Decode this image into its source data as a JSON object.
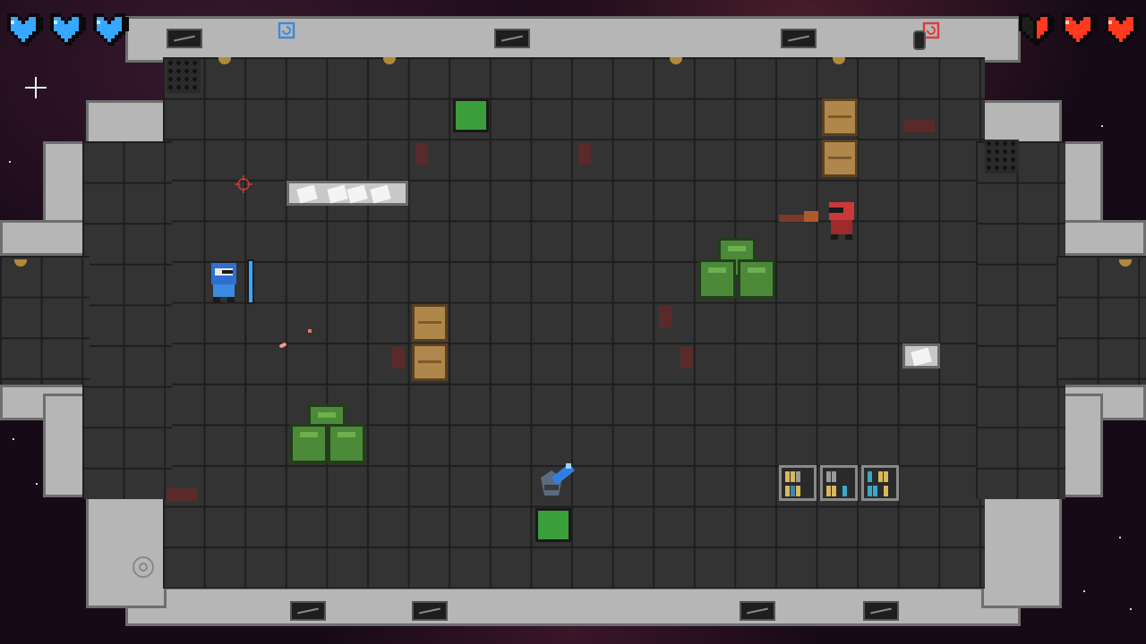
{
  "hud": {
    "blue_player": {
      "hearts_full": 3,
      "hearts_max": 3,
      "color": "#3aa8ff"
    },
    "red_player": {
      "hearts_full": 2.5,
      "hearts_max": 3,
      "color": "#ff3a2a"
    }
  },
  "icons": {
    "blue_spawn": "spawn-marker-icon",
    "red_spawn": "spawn-marker-icon",
    "crosshair": "crosshair-icon",
    "target": "target-icon"
  },
  "colors": {
    "blue_team": "#2f7fe0",
    "red_team": "#c83a3a",
    "floor": "#333333",
    "wall": "#b6b6b6"
  }
}
